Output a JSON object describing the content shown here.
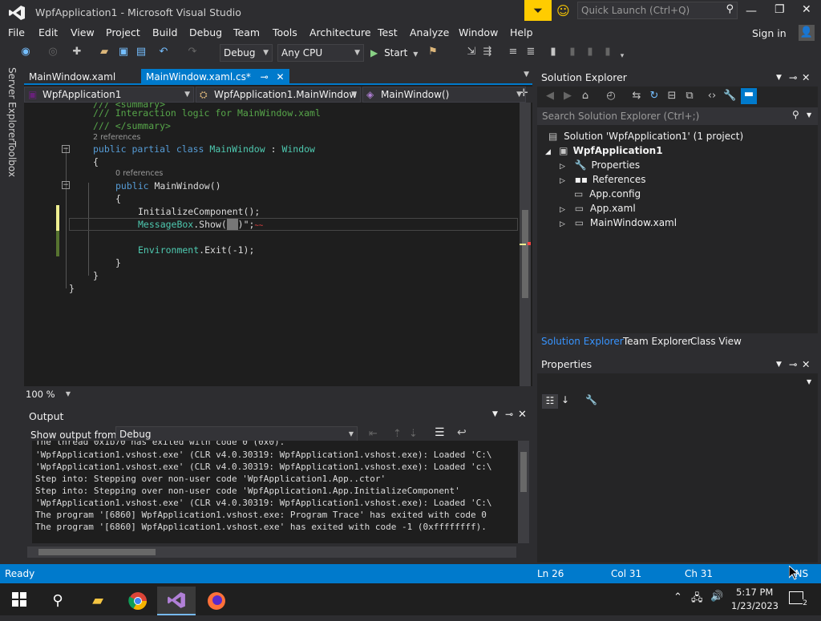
{
  "window": {
    "title": "WpfApplication1 - Microsoft Visual Studio",
    "quick_launch_placeholder": "Quick Launch (Ctrl+Q)",
    "sign_in": "Sign in"
  },
  "menu": [
    "File",
    "Edit",
    "View",
    "Project",
    "Build",
    "Debug",
    "Team",
    "Tools",
    "Architecture",
    "Test",
    "Analyze",
    "Window",
    "Help"
  ],
  "toolbar": {
    "config": "Debug",
    "platform": "Any CPU",
    "start": "Start"
  },
  "leftrail": {
    "server_explorer": "Server Explorer",
    "toolbox": "Toolbox"
  },
  "doc_tabs": {
    "tab1": "MainWindow.xaml",
    "tab2": "MainWindow.xaml.cs*",
    "pin": "⊸",
    "close": "✕"
  },
  "nav": {
    "project": "WpfApplication1",
    "class": "WpfApplication1.MainWindow",
    "member": "MainWindow()"
  },
  "code": {
    "l0": "/// <summary>",
    "l1": "/// Interaction logic for MainWindow.xaml",
    "l2": "/// </summary>",
    "lens1": "2 references",
    "l3_kw": "public partial class ",
    "l3_ty": "MainWindow",
    " l3_sep": " : ",
    "l3_base": "Window",
    "l4": "{",
    "lens2": "0 references",
    "l5_kw": "public ",
    "l5_name": "MainWindow()",
    "l6": "{",
    "l7": "InitializeComponent();",
    "l8_ty": "MessageBox",
    ".l8_rest": ".Show(",
    "l8_tail": ")\";",
    "l9_ty": "Environment",
    "l9_rest": ".Exit(-1);",
    "l10": "}",
    "l11": "}",
    "l12": "}"
  },
  "zoom": "100 %",
  "output": {
    "title": "Output",
    "show_from_label": "Show output from:",
    "source": "Debug",
    "lines": [
      "The thread 0x1b70 has exited with code 0 (0x0).",
      "'WpfApplication1.vshost.exe' (CLR v4.0.30319: WpfApplication1.vshost.exe): Loaded 'C:\\",
      "'WpfApplication1.vshost.exe' (CLR v4.0.30319: WpfApplication1.vshost.exe): Loaded 'c:\\",
      "Step into: Stepping over non-user code 'WpfApplication1.App..ctor'",
      "Step into: Stepping over non-user code 'WpfApplication1.App.InitializeComponent'",
      "'WpfApplication1.vshost.exe' (CLR v4.0.30319: WpfApplication1.vshost.exe): Loaded 'C:\\",
      "The program '[6860] WpfApplication1.vshost.exe: Program Trace' has exited with code 0",
      "The program '[6860] WpfApplication1.vshost.exe' has exited with code -1 (0xffffffff)."
    ]
  },
  "solution_explorer": {
    "title": "Solution Explorer",
    "search_placeholder": "Search Solution Explorer (Ctrl+;)",
    "solution": "Solution 'WpfApplication1' (1 project)",
    "project": "WpfApplication1",
    "items": [
      "Properties",
      "References",
      "App.config",
      "App.xaml",
      "MainWindow.xaml"
    ],
    "bottom_tabs": [
      "Solution Explorer",
      "Team Explorer",
      "Class View"
    ]
  },
  "properties": {
    "title": "Properties"
  },
  "status": {
    "ready": "Ready",
    "ln": "Ln 26",
    "col": "Col 31",
    "ch": "Ch 31",
    "ins": "INS"
  },
  "taskbar": {
    "time": "5:17 PM",
    "date": "1/23/2023",
    "notifications": "2"
  },
  "colors": {
    "accent": "#007acc",
    "background": "#2d2d30",
    "editor": "#1e1e1e"
  }
}
